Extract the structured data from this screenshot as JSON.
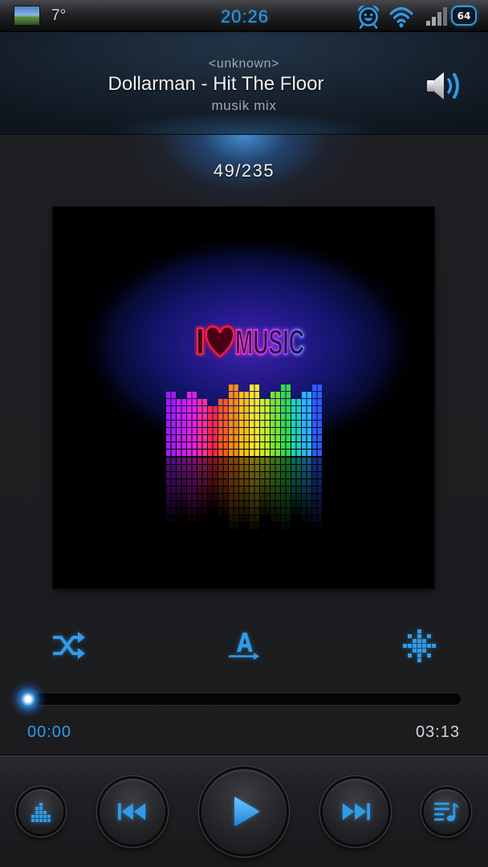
{
  "status_bar": {
    "temperature": "7°",
    "time": "20:26",
    "battery_level": "64"
  },
  "now_playing": {
    "artist": "<unknown>",
    "title": "Dollarman - Hit The Floor",
    "album": "musik mix",
    "queue_position": "49/235"
  },
  "album_art": {
    "lettering_left": "I",
    "lettering_right": "MUSIC"
  },
  "progress": {
    "elapsed": "00:00",
    "duration": "03:13",
    "fraction": 0
  },
  "icons": {
    "status": [
      "weather-thumbnail",
      "alarm-clock-icon",
      "wifi-icon",
      "signal-icon",
      "battery-icon"
    ],
    "header": [
      "speaker-icon"
    ],
    "album_art": [
      "heart-icon"
    ],
    "controls": [
      "shuffle-icon",
      "play-order-icon",
      "sound-effect-icon"
    ],
    "transport": [
      "equalizer-icon",
      "previous-icon",
      "play-icon",
      "next-icon",
      "playlist-icon"
    ]
  },
  "colors": {
    "accent": "#2f9be8",
    "background": "#1d1e21",
    "header": "#16202b",
    "text_primary": "#f2f2f2",
    "text_secondary": "#a3a8ad"
  }
}
